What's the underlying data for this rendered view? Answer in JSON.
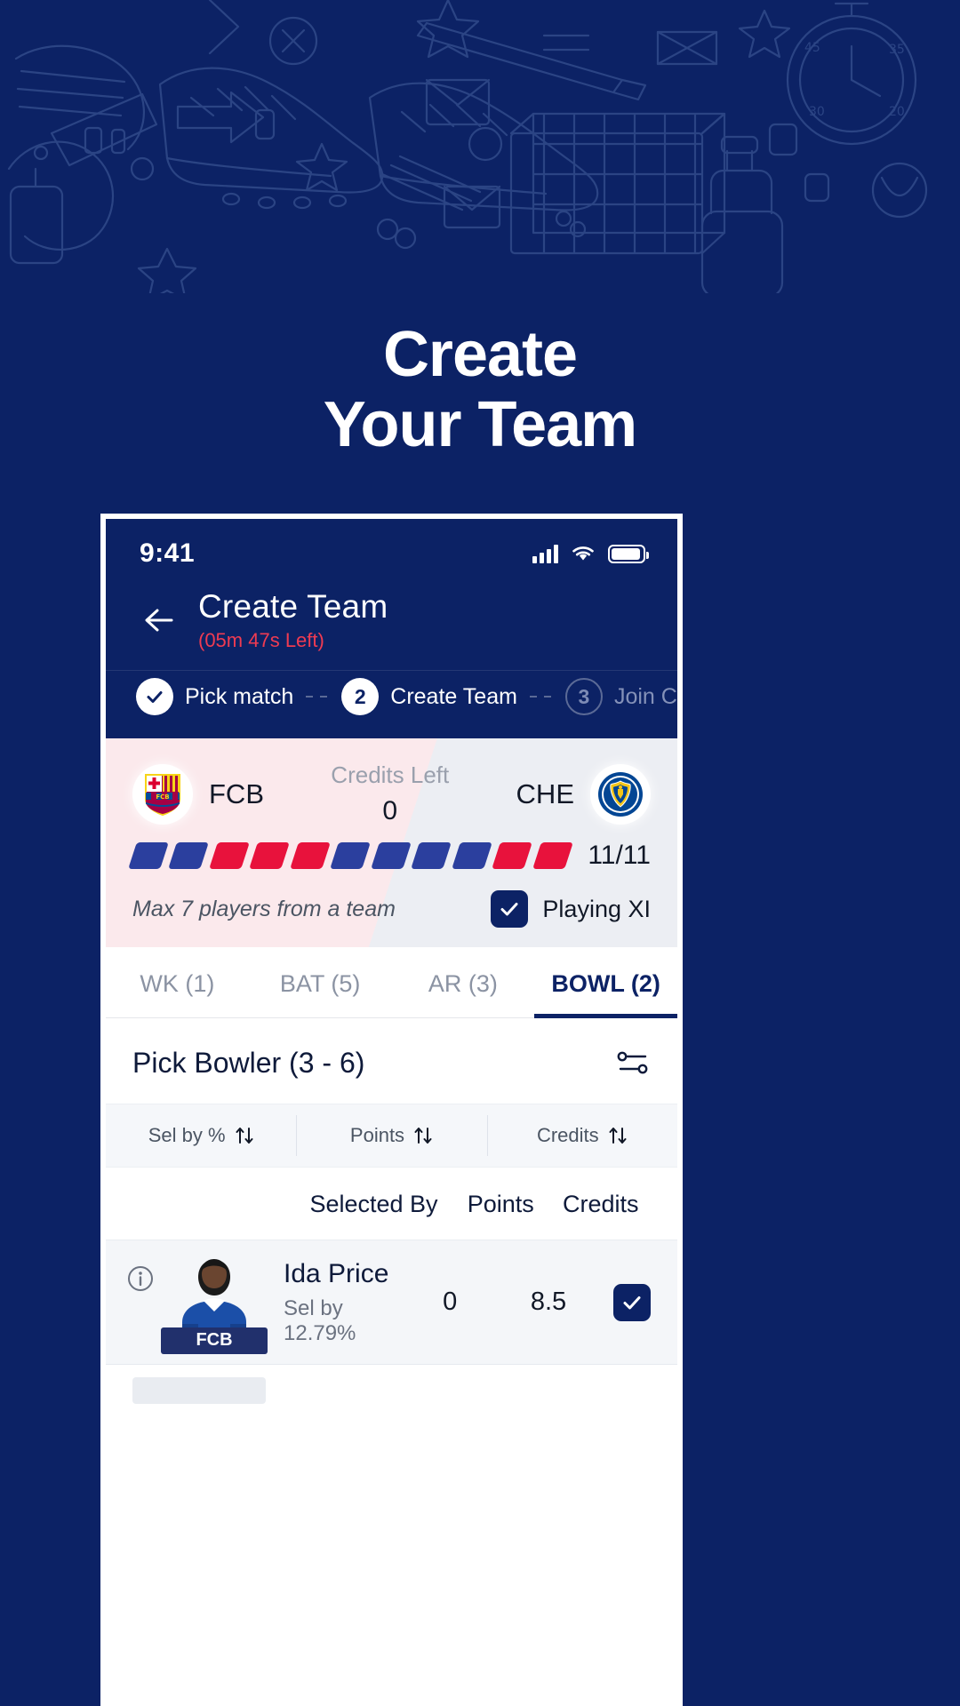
{
  "hero": {
    "line1": "Create",
    "line2": "Your Team"
  },
  "theme": {
    "navy": "#0c2265",
    "red": "#e8123c",
    "timer_red": "#ef3b52",
    "slot_blue": "#2b3f9e",
    "pink_panel": "#fbe9ec",
    "grey_panel": "#eceef3"
  },
  "statusbar": {
    "time": "9:41",
    "signal_icon": "signal-bars-icon",
    "wifi_icon": "wifi-icon",
    "battery_icon": "battery-full-icon"
  },
  "header": {
    "back_icon": "back-arrow-icon",
    "title": "Create Team",
    "timer": "(05m 47s Left)"
  },
  "stepper": {
    "steps": [
      {
        "label": "Pick match",
        "marker": "check",
        "state": "done"
      },
      {
        "label": "Create Team",
        "marker": "2",
        "state": "active"
      },
      {
        "label": "Join Contest",
        "marker": "3",
        "state": "todo"
      }
    ]
  },
  "credits_panel": {
    "team_left": {
      "code": "FCB",
      "crest_icon": "fcb-crest-icon"
    },
    "team_right": {
      "code": "CHE",
      "crest_icon": "che-crest-icon"
    },
    "credits_label": "Credits Left",
    "credits_value": "0",
    "slots": [
      "blue",
      "blue",
      "red",
      "red",
      "red",
      "blue",
      "blue",
      "blue",
      "blue",
      "red",
      "red"
    ],
    "slot_count": "11/11",
    "max_note": "Max 7 players from a team",
    "playing_xi_label": "Playing XI",
    "playing_xi_checked": true
  },
  "tabs": [
    {
      "label": "WK (1)",
      "active": false
    },
    {
      "label": "BAT (5)",
      "active": false
    },
    {
      "label": "AR (3)",
      "active": false
    },
    {
      "label": "BOWL (2)",
      "active": true
    }
  ],
  "pick_section": {
    "title": "Pick Bowler (3 - 6)",
    "sort_icon": "sort-settings-icon"
  },
  "filters": [
    {
      "label": "Sel by %",
      "icon": "sort-updown-icon"
    },
    {
      "label": "Points",
      "icon": "sort-updown-icon"
    },
    {
      "label": "Credits",
      "icon": "sort-updown-icon"
    }
  ],
  "column_headers": {
    "selected_by": "Selected By",
    "points": "Points",
    "credits": "Credits"
  },
  "players": [
    {
      "info_icon": "info-circle-icon",
      "avatar_icon": "player-avatar-icon",
      "team_badge": "FCB",
      "name": "Ida Price",
      "sel_by": "Sel by 12.79%",
      "points": "0",
      "credits": "8.5",
      "selected": true
    }
  ]
}
